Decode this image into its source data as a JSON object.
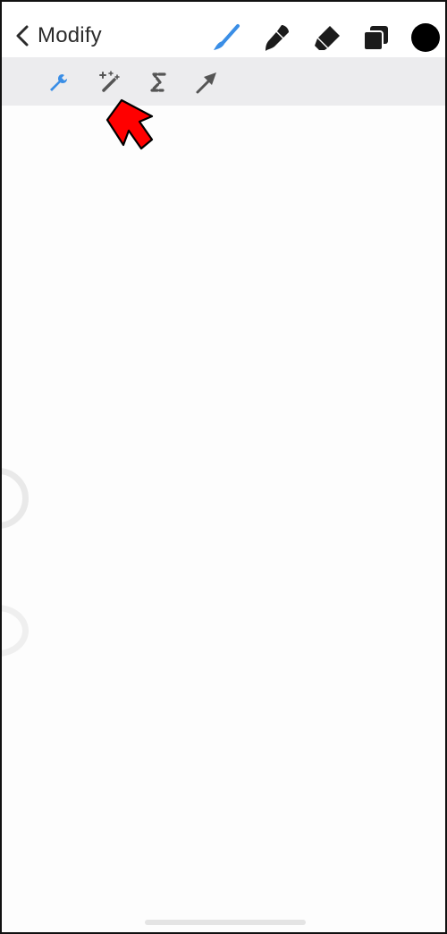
{
  "header": {
    "back_label": "Modify",
    "tools": [
      "brush-icon",
      "smudge-icon",
      "eraser-icon",
      "layers-icon",
      "color-swatch"
    ],
    "current_color": "#000000",
    "accent_color": "#3a8ee6"
  },
  "subtoolbar": {
    "tools": [
      "wrench-icon",
      "magic-wand-icon",
      "selection-icon",
      "transform-arrow-icon"
    ],
    "active": "wrench-icon"
  },
  "annotation": {
    "pointer": "red-arrow-icon",
    "points_to": "magic-wand-icon",
    "color": "#ff0000"
  }
}
